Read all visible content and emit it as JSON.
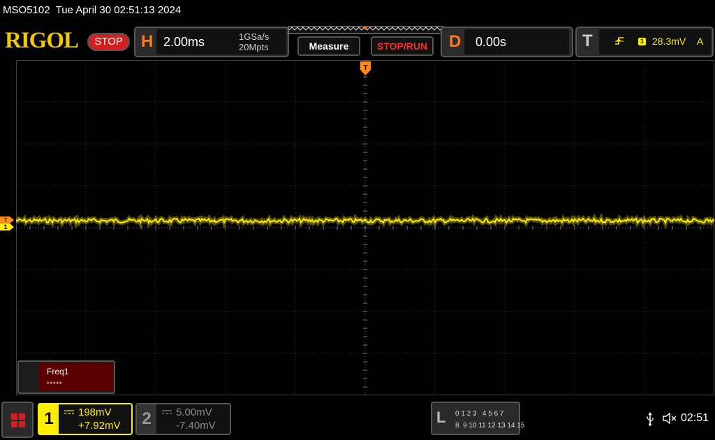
{
  "titlebar": {
    "text": "MSO5102  Tue April 30 02:51:13 2024"
  },
  "toolbar": {
    "logo": "RIGOL",
    "run_state": "STOP",
    "horizontal": {
      "letter": "H",
      "timebase": "2.00ms",
      "sample_rate": "1GSa/s",
      "memory_depth": "20Mpts"
    },
    "measure_label": "Measure",
    "stop_run_label": "STOP/RUN",
    "delay": {
      "letter": "D",
      "value": "0.00s"
    },
    "trigger": {
      "letter": "T",
      "source": "1",
      "level": "28.3mV",
      "mode": "A"
    }
  },
  "markers": {
    "trigger_pos": "T",
    "ch1_trigger": "T",
    "ch1_label": "1"
  },
  "measurement": {
    "name": "Freq1",
    "value": "*****"
  },
  "channels": [
    {
      "number": "1",
      "scale": "198mV",
      "offset": "+7.92mV",
      "color": "#ffee00",
      "active": true
    },
    {
      "number": "2",
      "scale": "5.00mV",
      "offset": "-7.40mV",
      "color": "#8a8a8a",
      "active": false
    }
  ],
  "logic": {
    "letter": "L",
    "row1": "0 1 2 3   4 5 6 7",
    "row2": "8  9 10 11 12 13 14 15"
  },
  "status": {
    "clock": "02:51"
  },
  "colors": {
    "accent_orange": "#ff7a1a",
    "ch1_yellow": "#ffee00",
    "stop_red": "#d02020",
    "logo_gold": "#f4c800"
  },
  "icons": [
    "home-menu-icon",
    "usb-icon",
    "speaker-muted-icon",
    "trigger-rising-edge-icon",
    "dc-coupling-icon"
  ]
}
